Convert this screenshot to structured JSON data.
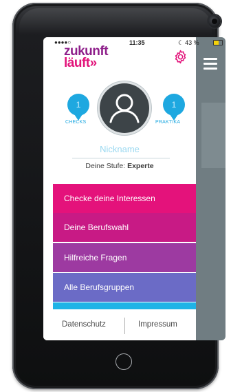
{
  "statusbar": {
    "signal": "●●●●○",
    "time": "11:35",
    "battery_text": "43 %"
  },
  "logo": {
    "line1": "zukunft",
    "line2": "läuft»"
  },
  "profile": {
    "checks_count": "1",
    "checks_label": "CHECKS",
    "praktika_count": "1",
    "praktika_label": "PRAKTIKA",
    "nickname": "Nickname",
    "level_prefix": "Deine Stufe: ",
    "level_value": "Experte"
  },
  "menu": {
    "items": [
      {
        "label": "Checke deine Interessen",
        "color": "#e4127b"
      },
      {
        "label": "Deine Berufswahl",
        "color": "#c81a85"
      },
      {
        "label": "Hilfreiche Fragen",
        "color": "#9d3aa1"
      },
      {
        "label": "Alle Berufsgruppen",
        "color": "#6b6bc6"
      }
    ],
    "strip_color": "#1fb3e6"
  },
  "footer": {
    "datenschutz": "Datenschutz",
    "impressum": "Impressum"
  },
  "icons": {
    "settings": "gear-icon",
    "menu": "hamburger-menu-icon",
    "avatar": "user-avatar-icon"
  },
  "colors": {
    "brand_purple": "#8e1f8a",
    "brand_pink": "#e2137a",
    "accent_blue": "#1ea8e0"
  }
}
